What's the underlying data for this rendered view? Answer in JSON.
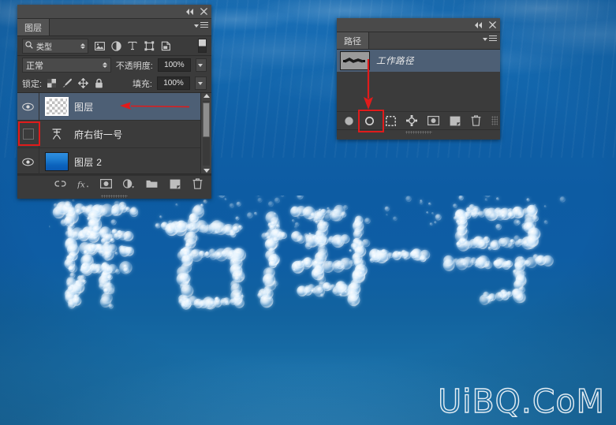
{
  "app": {
    "title_bar": {
      "collapse_icon": "collapse-double-left-icon",
      "close_icon": "close-icon"
    }
  },
  "layers_panel": {
    "tab_label": "图层",
    "menu_icon": "panel-menu-icon",
    "filter": {
      "search_icon": "search-icon",
      "kind_value": "类型",
      "icons": [
        {
          "name": "filter-pixel-icon",
          "title": "像素图层"
        },
        {
          "name": "filter-adjustment-icon",
          "title": "调整图层"
        },
        {
          "name": "filter-type-icon",
          "title": "文字图层"
        },
        {
          "name": "filter-shape-icon",
          "title": "形状图层"
        },
        {
          "name": "filter-smartobject-icon",
          "title": "智能对象"
        }
      ],
      "toggle_name": "filter-enable-toggle"
    },
    "blend_mode": "正常",
    "opacity_label": "不透明度:",
    "opacity_value": "100%",
    "lock_label": "锁定:",
    "lock_icons": [
      {
        "name": "lock-transparency-icon"
      },
      {
        "name": "lock-image-icon"
      },
      {
        "name": "lock-position-icon"
      },
      {
        "name": "lock-all-icon"
      }
    ],
    "fill_label": "填充:",
    "fill_value": "100%",
    "rows": [
      {
        "name": "图层",
        "visible": true,
        "selected": true,
        "thumb": "transparent-checker",
        "annotated_arrow": true
      },
      {
        "name": "府右街一号",
        "visible": false,
        "selected": false,
        "thumb": "type-layer",
        "annotated_box": true
      },
      {
        "name": "图层 2",
        "visible": true,
        "selected": false,
        "thumb": "water-photo"
      }
    ],
    "scrollbar": {
      "up_icon": "scroll-up-arrow-icon",
      "down_icon": "scroll-down-arrow-icon"
    },
    "footer_icons": [
      {
        "name": "link-layers-icon"
      },
      {
        "name": "layer-style-fx-icon"
      },
      {
        "name": "add-layer-mask-icon"
      },
      {
        "name": "new-adjustment-layer-icon"
      },
      {
        "name": "new-group-icon"
      },
      {
        "name": "new-layer-icon"
      },
      {
        "name": "delete-layer-icon"
      }
    ]
  },
  "paths_panel": {
    "tab_label": "路径",
    "menu_icon": "panel-menu-icon",
    "rows": [
      {
        "name": "工作路径",
        "selected": true,
        "thumb": "path-preview"
      }
    ],
    "footer_icons": [
      {
        "name": "fill-path-icon",
        "highlighted": false
      },
      {
        "name": "stroke-path-with-brush-icon",
        "highlighted": true
      },
      {
        "name": "load-path-as-selection-icon",
        "highlighted": false
      },
      {
        "name": "make-work-path-from-selection-icon",
        "highlighted": false
      },
      {
        "name": "add-layer-mask-icon",
        "highlighted": false
      },
      {
        "name": "new-path-icon",
        "highlighted": false
      },
      {
        "name": "delete-path-icon",
        "highlighted": false
      }
    ]
  },
  "canvas": {
    "bubble_text": "府右街一号",
    "watermark": "UiBQ.CoM"
  },
  "annotations": {
    "accent_color": "#e01b1b",
    "arrow_to_layer_name": "red-arrow-pointing-to-selected-layer",
    "box_on_hidden_eye": "red-box-around-hidden-visibility-toggle",
    "arrow_to_stroke_path": "red-arrow-pointing-to-stroke-path-button",
    "box_on_stroke_path": "red-box-around-stroke-path-button"
  },
  "colors": {
    "panel_bg": "#3b3b3b",
    "panel_header": "#4a4a4a",
    "selection_blue": "#4d5f75",
    "water_blue": "#0d5ca3"
  }
}
